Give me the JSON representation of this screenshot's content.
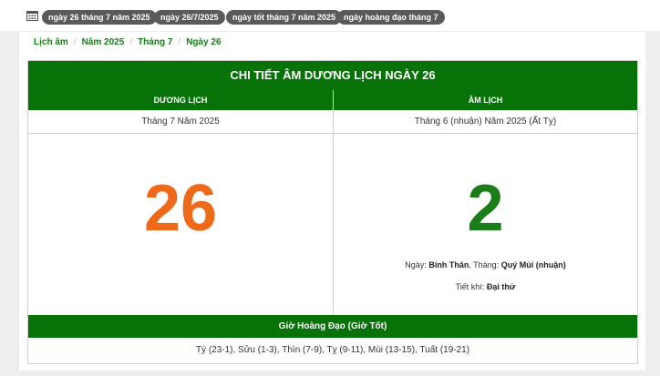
{
  "tags": [
    "ngày 26 tháng 7 năm 2025",
    "ngày 26/7/2025",
    "ngày tốt tháng 7 năm 2025",
    "ngày hoàng đạo tháng 7"
  ],
  "breadcrumb": {
    "items": [
      "Lịch âm",
      "Năm 2025",
      "Tháng 7",
      "Ngày 26"
    ],
    "separator": "/"
  },
  "calendar": {
    "title": "CHI TIẾT ÂM DƯƠNG LỊCH NGÀY 26",
    "solar": {
      "heading": "DƯƠNG LỊCH",
      "month_year": "Tháng 7 Năm 2025",
      "day": "26"
    },
    "lunar": {
      "heading": "ÂM LỊCH",
      "month_year": "Tháng 6 (nhuận) Năm 2025 (Ất Tỵ)",
      "day": "2",
      "day_label": "Ngày:",
      "day_name": "Bính Thân",
      "month_label": ", Tháng:",
      "month_name": "Quý Mùi (nhuận)",
      "solar_term_label": "Tiết khí:",
      "solar_term": "Đại thử"
    },
    "good_hours": {
      "heading": "Giờ Hoàng Đạo (Giờ Tốt)",
      "list": "Tý (23-1), Sửu (1-3), Thìn (7-9), Tỵ (9-11), Mùi (13-15), Tuất (19-21)"
    }
  },
  "colors": {
    "header_green": "#077207",
    "solar_day": "#ee6a1a",
    "lunar_day": "#1a7d1a",
    "tag_bg": "#5a5a5a"
  },
  "icons": {
    "calendar": "calendar-icon"
  }
}
